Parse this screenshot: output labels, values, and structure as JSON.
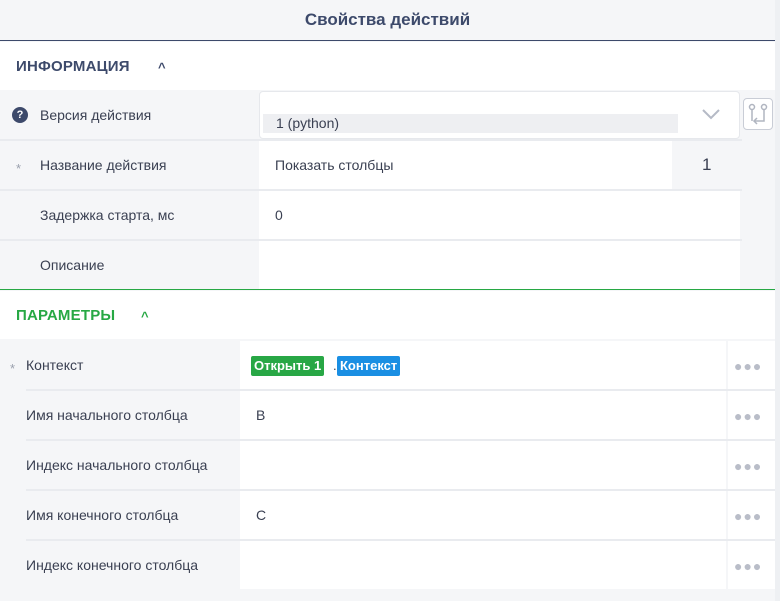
{
  "panel": {
    "title": "Свойства действий"
  },
  "info_section": {
    "title": "ИНФОРМАЦИЯ",
    "rows": {
      "version": {
        "label": "Версия действия",
        "value": "1 (python)"
      },
      "name": {
        "label": "Название действия",
        "value": "Показать столбцы",
        "counter": "1"
      },
      "delay": {
        "label": "Задержка старта, мс",
        "value": "0"
      },
      "description": {
        "label": "Описание",
        "value": ""
      }
    }
  },
  "params_section": {
    "title": "ПАРАМЕТРЫ",
    "rows": {
      "context": {
        "label": "Контекст",
        "tag_action": "Открыть 1",
        "tag_separator": ".",
        "tag_context": "Контекст"
      },
      "start_col_name": {
        "label": "Имя начального столбца",
        "value": "B"
      },
      "start_col_index": {
        "label": "Индекс начального столбца",
        "value": ""
      },
      "end_col_name": {
        "label": "Имя конечного столбца",
        "value": "C"
      },
      "end_col_index": {
        "label": "Индекс конечного столбца",
        "value": ""
      }
    }
  },
  "glyphs": {
    "chevron_up": "^",
    "required": "*",
    "help": "?",
    "more": "●●●"
  },
  "colors": {
    "accent_navy": "#3d4a6b",
    "accent_green": "#27a844",
    "tag_green": "#28a745",
    "tag_blue": "#1a8fe3"
  }
}
